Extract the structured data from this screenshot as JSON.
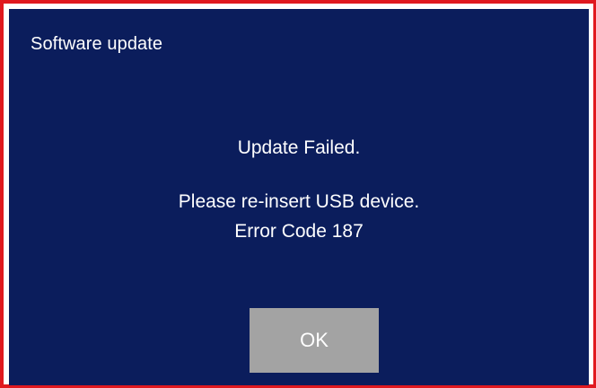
{
  "dialog": {
    "title": "Software update",
    "message_primary": "Update Failed.",
    "message_instruction": "Please re-insert USB device.",
    "message_error_code": "Error Code 187",
    "ok_label": "OK"
  },
  "colors": {
    "frame_border": "#e0191f",
    "dialog_background": "#0b1d5c",
    "button_background": "#a3a3a3",
    "text": "#ffffff"
  }
}
